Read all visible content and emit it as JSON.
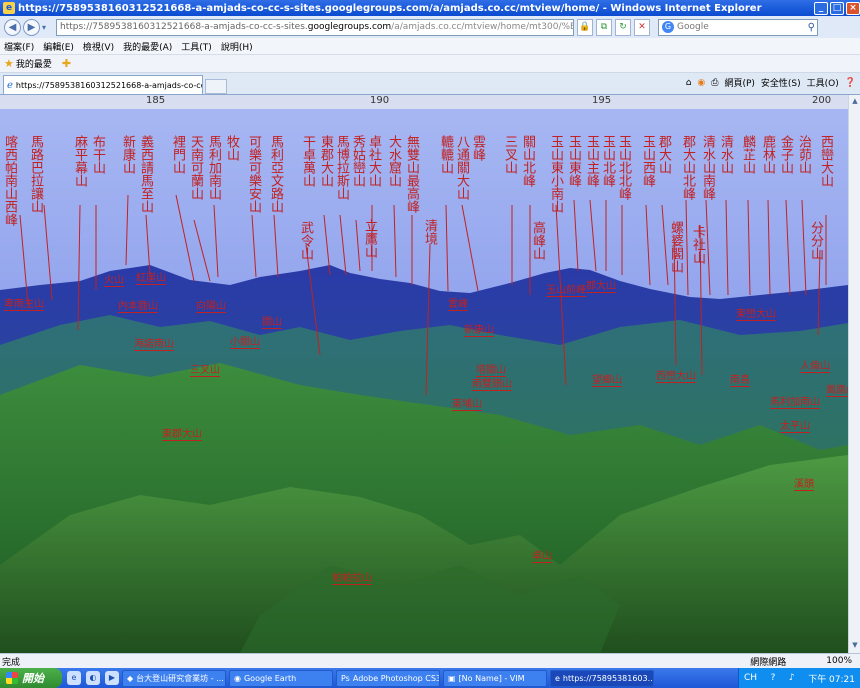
{
  "window": {
    "title": "https://7589538160312521668-a-amjads-co-cc-s-sites.googlegroups.com/a/amjads.co.cc/mtview/home/ - Windows Internet Explorer"
  },
  "address": {
    "url_start": "https://7589538160312521668-a-amjads-co-cc-s-sites.",
    "url_domain": "googlegroups.com",
    "url_rest": "/a/amjads.co.cc/mtview/home/mt300/%E9%9B%AA%E5%B1%B1%E4%B8%BB%",
    "search_placeholder": "Google"
  },
  "menu": [
    "檔案(F)",
    "編輯(E)",
    "檢視(V)",
    "我的最愛(A)",
    "工具(T)",
    "說明(H)"
  ],
  "favorites": {
    "label": "我的最愛"
  },
  "tab": {
    "title": "https://7589538160312521668-a-amjads-co-cc-s-sites.g..."
  },
  "toolbar": {
    "page": "網頁(P)",
    "safety": "安全性(S)",
    "tools": "工具(O)"
  },
  "status": {
    "done": "完成",
    "zone": "網際網路",
    "zoom": "100%"
  },
  "taskbar": {
    "start": "開始",
    "tasks": [
      "台大登山研究會業坊 - ...",
      "Google Earth",
      "Adobe Photoshop CS3...",
      "[No Name] - VIM",
      "https://75895381603..."
    ],
    "tray_lang": "CH",
    "clock": "下午 07:21"
  },
  "panorama": {
    "ticks": [
      "185",
      "190",
      "195",
      "200"
    ],
    "vertical_labels": [
      "喀西帕南山西峰",
      "馬路巴拉讓山",
      "麻平幕山",
      "布干山",
      "新康山",
      "義西請馬至山",
      "裡門山",
      "天南可蘭山",
      "馬利加南山",
      "牧山",
      "可樂可樂安山",
      "馬利亞文路山",
      "干卓萬山",
      "東郡大山",
      "馬博拉斯山",
      "秀姑巒山",
      "卓社大山",
      "大水窟山",
      "無雙山最高峰",
      "轆轆山",
      "八通關大山",
      "雲峰",
      "三叉山",
      "關山北峰",
      "玉山東小南山",
      "玉山東峰",
      "玉山主峰",
      "玉山北峰",
      "玉山北北峰",
      "玉山西峰",
      "郡大山",
      "郡大山北峰",
      "清水山南峰",
      "清水山",
      "麟芷山",
      "鹿林山",
      "金子山",
      "治茆山",
      "西巒大山",
      "武令山",
      "立鷹山",
      "清境",
      "高峰山",
      "螺婆閣山",
      "卡社山",
      "分分山"
    ],
    "horizontal_labels": [
      "火山",
      "紅崖山",
      "卑南主山",
      "內本鹿山",
      "向陽山",
      "關山",
      "海諾南山",
      "小關山",
      "三叉山",
      "雲峰",
      "新康山",
      "塔關山",
      "南雙頭山",
      "東埔山",
      "玉山前峰",
      "郡大山",
      "望鄉山",
      "西巒大山",
      "東巒大山",
      "南島",
      "人倫山",
      "鳳凰山",
      "馬利加南山",
      "太平山",
      "東郡大山",
      "溪頭",
      "卓山",
      "帕帕拉山"
    ]
  }
}
